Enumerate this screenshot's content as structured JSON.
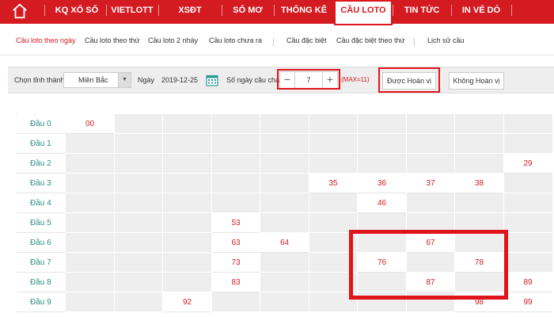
{
  "nav": {
    "items": [
      "KQ XỔ SỐ",
      "VIETLOTT",
      "XSĐT",
      "SỔ MƠ",
      "THỐNG KÊ",
      "CẦU LOTO",
      "TIN TỨC",
      "IN VÉ DÒ"
    ],
    "active_index": 5,
    "brand_color": "#d41b21"
  },
  "subnav": {
    "items": [
      "Cầu loto theo ngày",
      "Cầu loto theo thứ",
      "Cầu loto 2 nháy",
      "Cầu loto chưa ra",
      "Cầu đặc biệt",
      "Cầu đặc biệt theo thứ",
      "Lịch sử cầu"
    ],
    "active_index": 0
  },
  "filters": {
    "province_label": "Chọn tỉnh thành",
    "province_value": "Miền Bắc",
    "date_label": "Ngày",
    "date_value": "2019-12-25",
    "days_label": "Số ngày cầu chạy",
    "days_value": "7",
    "max_note": "(MAX=11)",
    "btn_swap": "Được Hoán vị",
    "btn_noswap": "Không Hoán vị"
  },
  "grid": {
    "rows": [
      {
        "label": "Đầu 0",
        "cells": [
          "00",
          "",
          "",
          "",
          "",
          "",
          "",
          "",
          "",
          ""
        ]
      },
      {
        "label": "Đầu 1",
        "cells": [
          "",
          "",
          "",
          "",
          "",
          "",
          "",
          "",
          "",
          ""
        ]
      },
      {
        "label": "Đầu 2",
        "cells": [
          "",
          "",
          "",
          "",
          "",
          "",
          "",
          "",
          "",
          "29"
        ]
      },
      {
        "label": "Đầu 3",
        "cells": [
          "",
          "",
          "",
          "",
          "",
          "35",
          "36",
          "37",
          "38",
          ""
        ]
      },
      {
        "label": "Đầu 4",
        "cells": [
          "",
          "",
          "",
          "",
          "",
          "",
          "46",
          "",
          "",
          ""
        ]
      },
      {
        "label": "Đầu 5",
        "cells": [
          "",
          "",
          "",
          "53",
          "",
          "",
          "",
          "",
          "",
          ""
        ]
      },
      {
        "label": "Đầu 6",
        "cells": [
          "",
          "",
          "",
          "63",
          "64",
          "",
          "",
          "67",
          "",
          ""
        ]
      },
      {
        "label": "Đầu 7",
        "cells": [
          "",
          "",
          "",
          "73",
          "",
          "",
          "76",
          "",
          "78",
          ""
        ]
      },
      {
        "label": "Đầu 8",
        "cells": [
          "",
          "",
          "",
          "83",
          "",
          "",
          "",
          "87",
          "",
          "89"
        ]
      },
      {
        "label": "Đầu 9",
        "cells": [
          "",
          "",
          "92",
          "",
          "",
          "",
          "",
          "",
          "98",
          "99"
        ]
      }
    ]
  }
}
